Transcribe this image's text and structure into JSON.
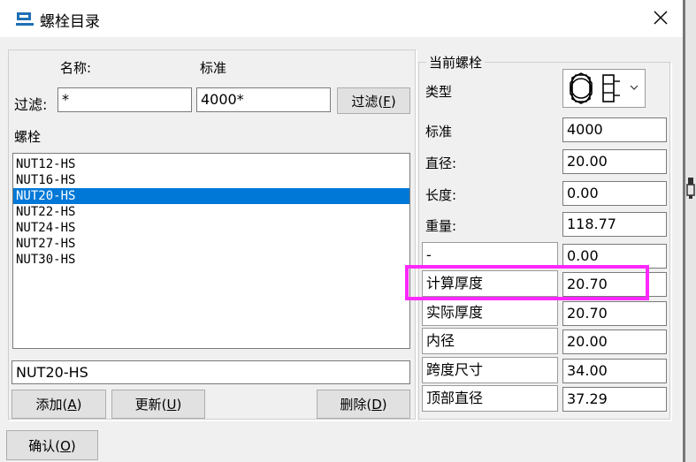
{
  "window": {
    "title": "螺栓目录",
    "close_glyph": "✕"
  },
  "filter": {
    "name_header": "名称:",
    "standard_header": "标准",
    "label": "过滤:",
    "name_value": "*",
    "standard_value": "4000*",
    "button_prefix": "过滤(",
    "button_key": "F",
    "button_suffix": ")"
  },
  "bolts": {
    "header": "螺栓",
    "items": [
      "NUT12-HS",
      "NUT16-HS",
      "NUT20-HS",
      "NUT22-HS",
      "NUT24-HS",
      "NUT27-HS",
      "NUT30-HS"
    ],
    "selected_index": 2,
    "current_name": "NUT20-HS"
  },
  "buttons": {
    "add": {
      "prefix": "添加(",
      "key": "A",
      "suffix": ")"
    },
    "update": {
      "prefix": "更新(",
      "key": "U",
      "suffix": ")"
    },
    "delete": {
      "prefix": "删除(",
      "key": "D",
      "suffix": ")"
    },
    "ok": {
      "prefix": "确认(",
      "key": "O",
      "suffix": ")"
    }
  },
  "current": {
    "group_title": "当前螺栓",
    "type_label": "类型",
    "type_icon": "nut-icon",
    "standard_label": "标准",
    "standard_value": "4000",
    "diameter_label": "直径:",
    "diameter_value": "20.00",
    "length_label": "长度:",
    "length_value": "0.00",
    "weight_label": "重量:",
    "weight_value": "118.77",
    "rows": [
      {
        "label": "-",
        "value": "0.00"
      },
      {
        "label": "计算厚度",
        "value": "20.70"
      },
      {
        "label": "实际厚度",
        "value": "20.70"
      },
      {
        "label": "内径",
        "value": "20.00"
      },
      {
        "label": "跨度尺寸",
        "value": "34.00"
      },
      {
        "label": "顶部直径",
        "value": "37.29"
      }
    ]
  },
  "colors": {
    "selection": "#0078d7",
    "highlight": "#ff28ff"
  }
}
